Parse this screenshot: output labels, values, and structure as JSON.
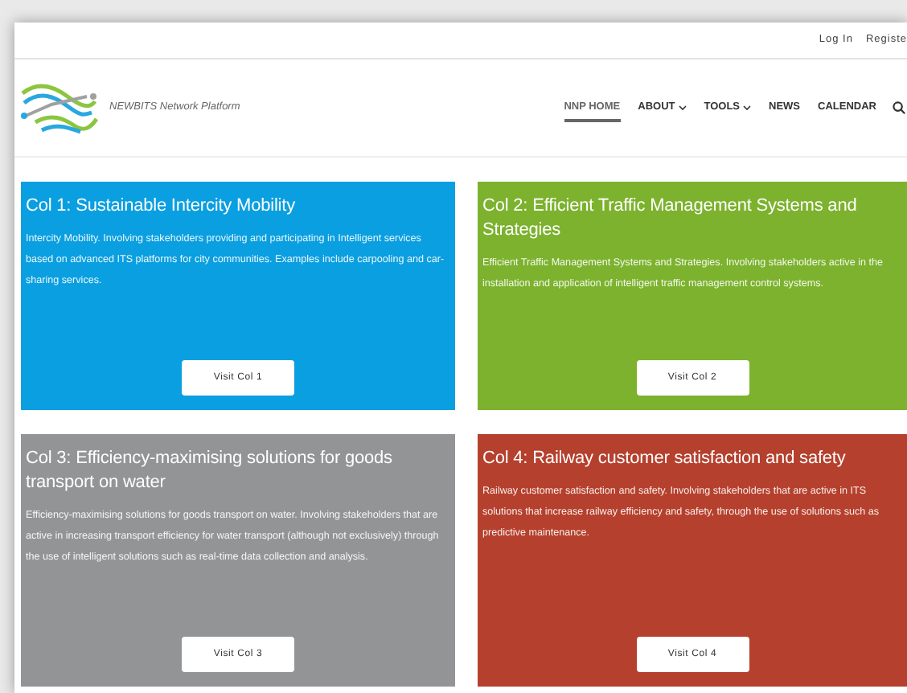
{
  "top_bar": {
    "links": [
      "Log In",
      "Registe"
    ]
  },
  "header": {
    "site_name": "NEWBITS Network Platform",
    "nav": [
      {
        "label": "NNP HOME",
        "selected": true,
        "dropdown": false
      },
      {
        "label": "ABOUT",
        "selected": false,
        "dropdown": true
      },
      {
        "label": "TOOLS",
        "selected": false,
        "dropdown": true
      },
      {
        "label": "NEWS",
        "selected": false,
        "dropdown": false
      },
      {
        "label": "CALENDAR",
        "selected": false,
        "dropdown": false
      }
    ]
  },
  "cards": [
    {
      "title": "Col 1: Sustainable Intercity Mobility",
      "text": "Intercity Mobility. Involving stakeholders providing and participating in Intelligent services based on advanced ITS platforms for city communities. Examples include carpooling and car-sharing services.",
      "button": "Visit Col 1",
      "color": "#0a9fe0"
    },
    {
      "title": "Col 2: Efficient Traffic Management Systems and Strategies",
      "text": "Efficient Traffic Management Systems and Strategies. Involving stakeholders active in the installation and application of intelligent traffic management control systems.",
      "button": "Visit Col 2",
      "color": "#7cb22e"
    },
    {
      "title": "Col 3: Efficiency-maximising solutions for goods transport on water",
      "text": "Efficiency-maximising solutions for goods transport on water. Involving stakeholders that are active in increasing transport efficiency for water transport (although not exclusively) through the use of intelligent solutions such as real-time data collection and analysis.",
      "button": "Visit Col 3",
      "color": "#939496"
    },
    {
      "title": "Col 4: Railway customer satisfaction and safety",
      "text": "Railway customer satisfaction and safety. Involving stakeholders that are active in ITS solutions that increase railway efficiency and safety, through the use of solutions such as predictive maintenance.",
      "button": "Visit Col 4",
      "color": "#b5402d"
    }
  ]
}
